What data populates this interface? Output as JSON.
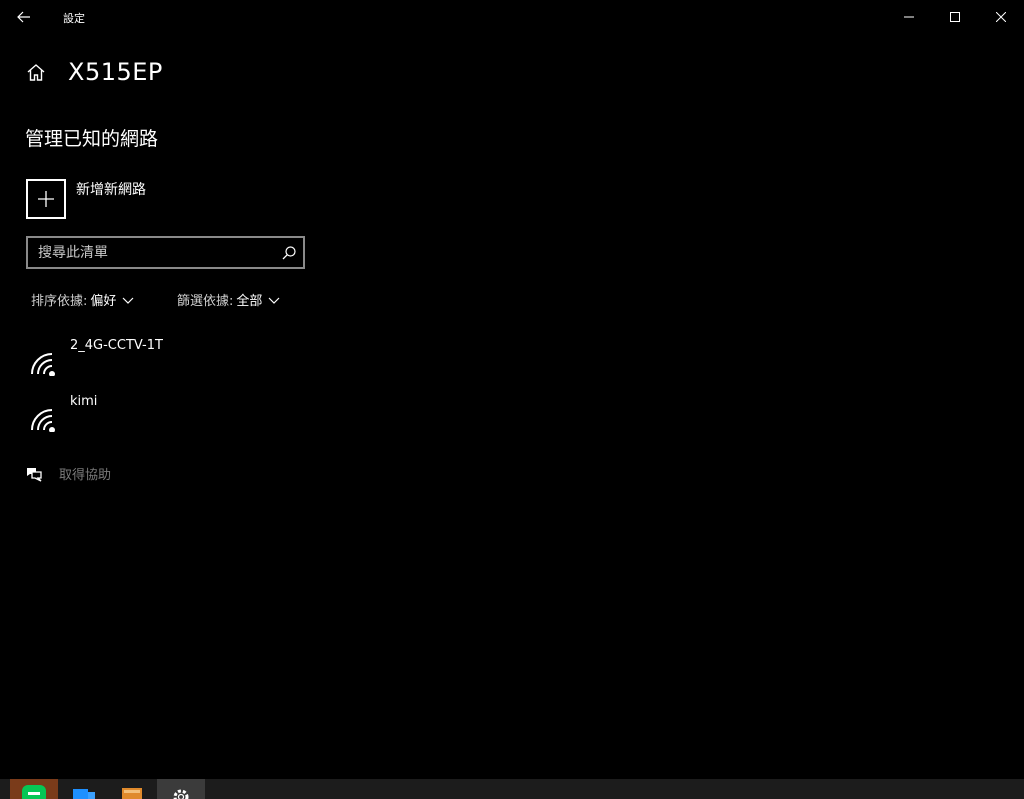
{
  "window": {
    "title": "設定",
    "back_icon": "back-arrow-icon"
  },
  "header": {
    "home_icon": "home-icon",
    "title": "X515EP"
  },
  "section": {
    "title": "管理已知的網路"
  },
  "add_network": {
    "icon": "plus-icon",
    "label": "新增新網路"
  },
  "search": {
    "placeholder": "搜尋此清單",
    "value": "",
    "icon": "search-icon"
  },
  "sort": {
    "label": "排序依據:",
    "value": "偏好"
  },
  "filter": {
    "label": "篩選依據:",
    "value": "全部"
  },
  "networks": [
    {
      "name": "2_4G-CCTV-1T",
      "icon": "wifi-icon"
    },
    {
      "name": "kimi",
      "icon": "wifi-icon"
    }
  ],
  "help": {
    "icon": "chat-help-icon",
    "label": "取得協助"
  },
  "taskbar": {
    "items": [
      {
        "name": "line-app",
        "icon": "line-icon",
        "color": "#06c755"
      },
      {
        "name": "file-explorer",
        "icon": "folder-icon",
        "color": "#1e90ff"
      },
      {
        "name": "app-orange",
        "icon": "app-icon",
        "color": "#e08a2c"
      },
      {
        "name": "settings",
        "icon": "gear-icon",
        "color": "#ffffff"
      }
    ]
  }
}
